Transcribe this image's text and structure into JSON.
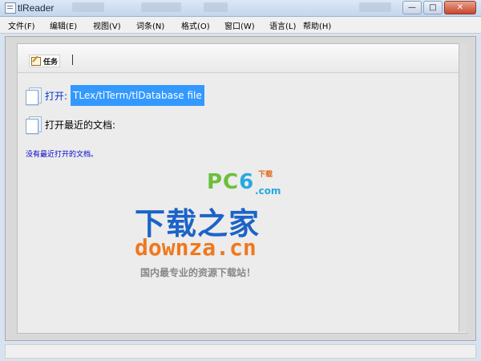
{
  "window": {
    "title": "tlReader",
    "btn_minimize": "—",
    "btn_maximize": "□",
    "btn_close": "✕"
  },
  "menu": {
    "items": [
      {
        "label": "文件(F)"
      },
      {
        "label": "编辑(E)"
      },
      {
        "label": "视图(V)"
      },
      {
        "label": "词条(N)"
      },
      {
        "label": "格式(O)"
      },
      {
        "label": "窗口(W)"
      },
      {
        "label": "语言(L)"
      },
      {
        "label": "帮助(H)"
      }
    ]
  },
  "tasks": {
    "button_label": "任务",
    "separator": "|"
  },
  "content": {
    "open_label": "打开:",
    "open_path": "TLex/tlTerm/tlDatabase file",
    "recent_label": "打开最近的文档:",
    "no_recent": "没有最近打开的文档。"
  },
  "watermark": {
    "pc6_prefix": "PC",
    "pc6_six": "6",
    "pc6_xz": "下载",
    "pc6_com": ".com",
    "brand": "下载之家",
    "domain": "downza.cn",
    "slogan": "国内最专业的资源下载站！"
  }
}
